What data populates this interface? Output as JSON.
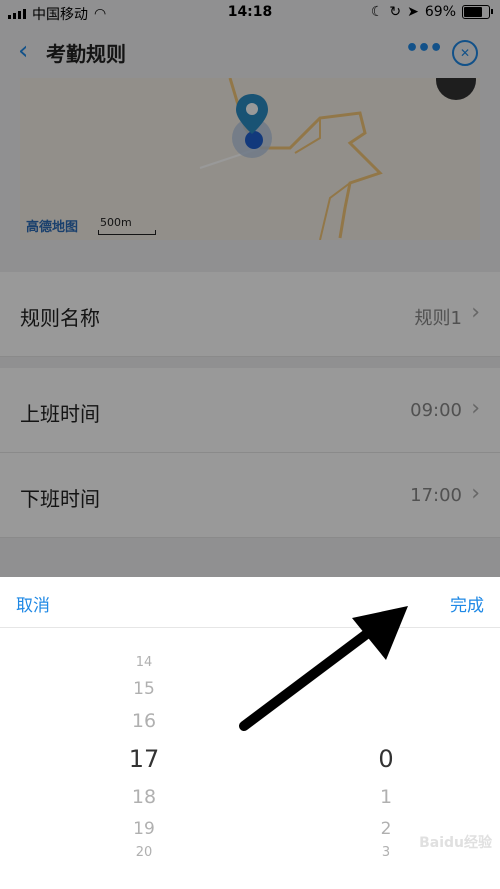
{
  "status": {
    "carrier": "中国移动",
    "time": "14:18",
    "battery": "69%",
    "battery_level": 0.69
  },
  "nav": {
    "back_icon": "chevron-left-icon",
    "title": "考勤规则",
    "more_icon": "more-icon",
    "close_icon": "close-circle-icon"
  },
  "map": {
    "provider_logo": "高德地图",
    "scale_label": "500m",
    "accent": "#1e88e5"
  },
  "rows": [
    {
      "label": "规则名称",
      "value": "规则1"
    },
    {
      "label": "上班时间",
      "value": "09:00"
    },
    {
      "label": "下班时间",
      "value": "17:00"
    }
  ],
  "picker": {
    "cancel_label": "取消",
    "done_label": "完成",
    "hours": [
      "14",
      "15",
      "16",
      "17",
      "18",
      "19",
      "20"
    ],
    "hours_selected": "17",
    "minutes": [
      "0",
      "1",
      "2",
      "3"
    ],
    "minutes_selected": "0"
  },
  "watermark": "Baidu经验"
}
